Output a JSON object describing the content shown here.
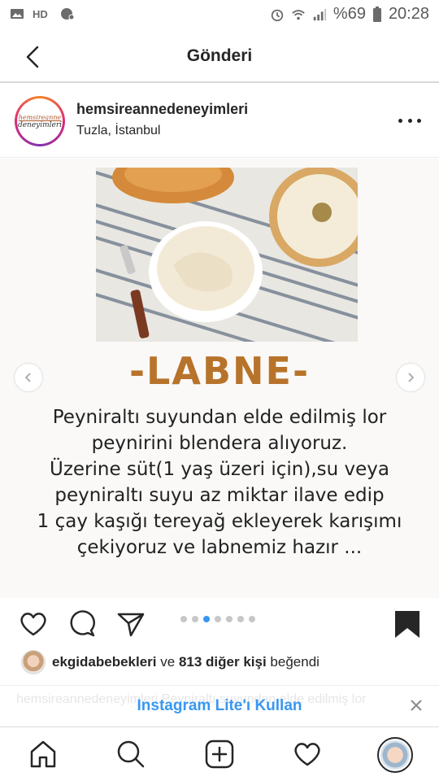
{
  "status_bar": {
    "battery_percent": "%69",
    "time": "20:28"
  },
  "header": {
    "title": "Gönderi"
  },
  "post": {
    "username": "hemsireannedeneyimleri",
    "location": "Tuzla, İstanbul",
    "avatar_text_line1": "hemsireanne",
    "avatar_text_line2": "deneyimleri",
    "image_title": "-LABNE-",
    "image_text_lines": [
      "Peyniraltı suyundan elde edilmiş lor",
      "peynirini blendera alıyoruz.",
      "Üzerine süt(1 yaş üzeri için),su veya",
      "peyniraltı suyu az miktar ilave edip",
      "1 çay kaşığı tereyağ ekleyerek karışımı",
      "çekiyoruz ve labnemiz hazır ..."
    ],
    "carousel": {
      "total": 7,
      "active_index": 2
    }
  },
  "likes": {
    "user": "ekgidabebekleri",
    "connector": "ve",
    "others": "813 diğer kişi",
    "suffix": "beğendi"
  },
  "lite_banner": {
    "link": "Instagram Lite'ı Kullan",
    "background_text": "hemsireannedeneyimleri Peyniraltı suyundan elde edilmiş lor"
  },
  "icons": {
    "status_left": [
      "gallery-icon",
      "hd-icon",
      "shield-icon"
    ],
    "status_right": [
      "alarm-icon",
      "wifi-icon",
      "signal-icon",
      "battery-icon"
    ],
    "actions": [
      "heart-icon",
      "comment-icon",
      "share-icon",
      "bookmark-icon"
    ],
    "bottom_nav": [
      "home-icon",
      "search-icon",
      "add-post-icon",
      "activity-heart-icon",
      "profile-avatar"
    ]
  },
  "colors": {
    "accent_blue": "#3897f0",
    "title_brown": "#b8732b",
    "text": "#262626"
  }
}
